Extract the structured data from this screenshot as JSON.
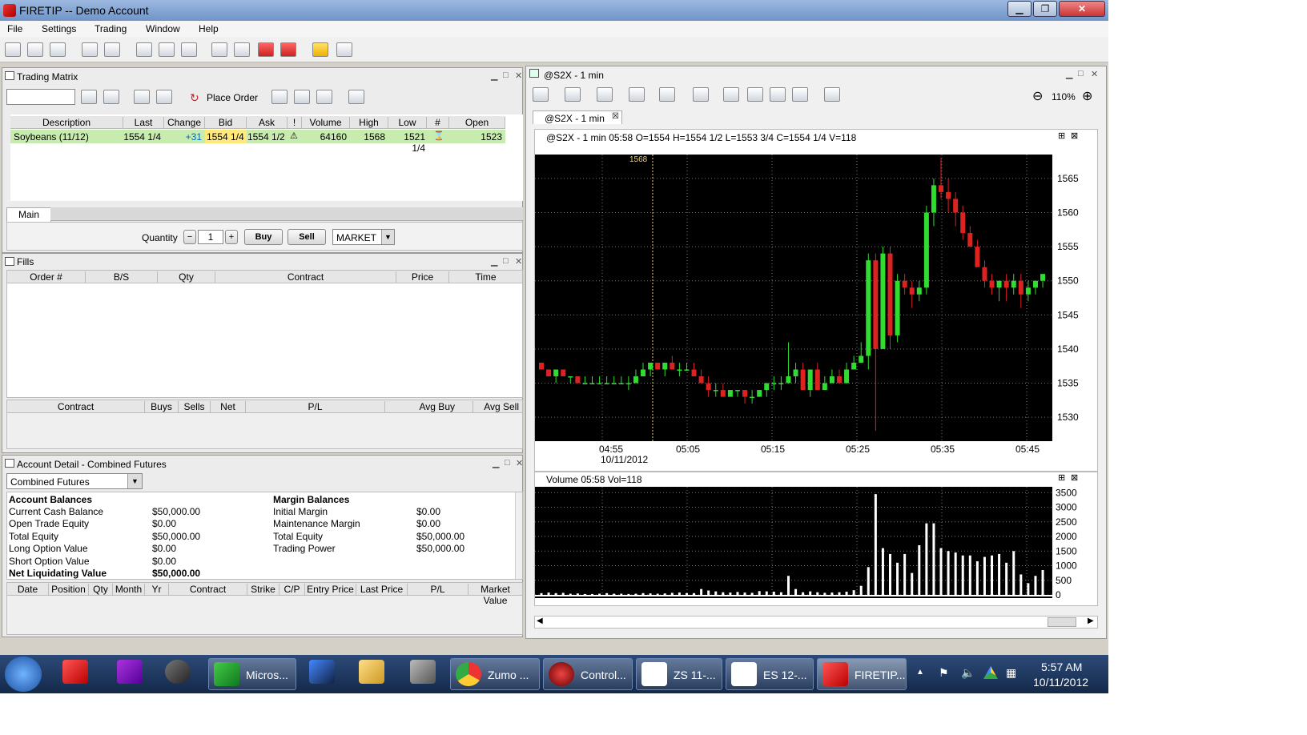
{
  "window": {
    "title": "FIRETIP -- Demo Account"
  },
  "menu": [
    "File",
    "Settings",
    "Trading",
    "Window",
    "Help"
  ],
  "trading_matrix": {
    "title": "Trading Matrix",
    "place_order": "Place Order",
    "columns": [
      "Description",
      "Last",
      "Change",
      "Bid",
      "Ask",
      "!",
      "Volume",
      "High",
      "Low",
      "#",
      "Open"
    ],
    "row": {
      "description": "Soybeans (11/12)",
      "last": "1554 1/4",
      "change": "+31",
      "bid": "1554 1/4",
      "ask": "1554 1/2",
      "volume": "64160",
      "high": "1568",
      "low": "1521 1/4",
      "open": "1523"
    },
    "tab": "Main",
    "quantity_label": "Quantity",
    "quantity_minus": "−",
    "quantity_plus": "+",
    "quantity": "1",
    "buy": "Buy",
    "sell": "Sell",
    "order_type": "MARKET"
  },
  "fills": {
    "title": "Fills",
    "columns": [
      "Order #",
      "B/S",
      "Qty",
      "Contract",
      "Price",
      "Time"
    ],
    "summary_columns": [
      "Contract",
      "Buys",
      "Sells",
      "Net",
      "P/L",
      "Avg Buy",
      "Avg Sell"
    ]
  },
  "account": {
    "title": "Account Detail - Combined Futures",
    "selector": "Combined Futures",
    "balances_heading": "Account Balances",
    "balances": [
      {
        "label": "Current Cash Balance",
        "value": "$50,000.00"
      },
      {
        "label": "Open Trade Equity",
        "value": "$0.00"
      },
      {
        "label": "Total Equity",
        "value": "$50,000.00"
      },
      {
        "label": "Long Option Value",
        "value": "$0.00"
      },
      {
        "label": "Short Option Value",
        "value": "$0.00"
      },
      {
        "label": "Net Liquidating Value",
        "value": "$50,000.00"
      }
    ],
    "margin_heading": "Margin Balances",
    "margins": [
      {
        "label": "Initial Margin",
        "value": "$0.00"
      },
      {
        "label": "Maintenance Margin",
        "value": "$0.00"
      },
      {
        "label": "Total Equity",
        "value": "$50,000.00"
      },
      {
        "label": "Trading Power",
        "value": "$50,000.00"
      }
    ],
    "position_columns": [
      "Date",
      "Position",
      "Qty",
      "Month",
      "Yr",
      "Contract",
      "Strike",
      "C/P",
      "Entry Price",
      "Last Price",
      "P/L",
      "Market Value"
    ]
  },
  "chart_window": {
    "title": "@S2X - 1 min",
    "tab": "@S2X - 1 min",
    "zoom": "110%",
    "header": "@S2X - 1 min 05:58 O=1554 H=1554 1/2 L=1553 3/4 C=1554 1/4 V=118",
    "marker": "1568",
    "volume_header": "Volume 05:58 Vol=118"
  },
  "chart_data": {
    "type": "candlestick",
    "price_ticks": [
      1565,
      1560,
      1555,
      1550,
      1545,
      1540,
      1535,
      1530
    ],
    "ylim": [
      1526.5,
      1568.5
    ],
    "x_ticks": [
      "04:55",
      "05:05",
      "05:15",
      "05:25",
      "05:35",
      "05:45"
    ],
    "x_tick_sub": "10/11/2012",
    "volume_ticks": [
      3500,
      3000,
      2500,
      2000,
      1500,
      1000,
      500,
      0
    ],
    "volume_ylim": [
      0,
      3700
    ],
    "candles": [
      [
        1538,
        1538,
        1537,
        1537
      ],
      [
        1537,
        1537,
        1536,
        1536
      ],
      [
        1536,
        1537,
        1535,
        1537
      ],
      [
        1537,
        1537,
        1536,
        1536
      ],
      [
        1536,
        1536,
        1535,
        1536
      ],
      [
        1536,
        1536,
        1535,
        1535
      ],
      [
        1535,
        1536,
        1535,
        1535
      ],
      [
        1535,
        1536,
        1535,
        1535
      ],
      [
        1535,
        1536,
        1535,
        1535
      ],
      [
        1535,
        1536,
        1535,
        1535
      ],
      [
        1535,
        1536,
        1535,
        1535
      ],
      [
        1535,
        1536,
        1535,
        1535
      ],
      [
        1535,
        1536,
        1534,
        1535
      ],
      [
        1535,
        1537,
        1535,
        1536
      ],
      [
        1536,
        1538,
        1536,
        1537
      ],
      [
        1537,
        1538,
        1536,
        1538
      ],
      [
        1538,
        1538,
        1537,
        1537
      ],
      [
        1537,
        1538,
        1536,
        1538
      ],
      [
        1538,
        1539,
        1537,
        1537
      ],
      [
        1537,
        1538,
        1536,
        1537
      ],
      [
        1537,
        1538,
        1537,
        1537
      ],
      [
        1537,
        1538,
        1536,
        1536
      ],
      [
        1536,
        1537,
        1535,
        1535
      ],
      [
        1535,
        1536,
        1533,
        1534
      ],
      [
        1534,
        1535,
        1533,
        1534
      ],
      [
        1534,
        1535,
        1533,
        1533
      ],
      [
        1533,
        1534,
        1533,
        1534
      ],
      [
        1534,
        1534,
        1533,
        1534
      ],
      [
        1534,
        1534,
        1532,
        1533
      ],
      [
        1533,
        1534,
        1532,
        1533
      ],
      [
        1533,
        1534,
        1533,
        1534
      ],
      [
        1534,
        1535,
        1533,
        1535
      ],
      [
        1535,
        1536,
        1534,
        1535
      ],
      [
        1535,
        1536,
        1534,
        1535
      ],
      [
        1535,
        1541,
        1535,
        1536
      ],
      [
        1536,
        1538,
        1535,
        1537
      ],
      [
        1537,
        1538,
        1534,
        1534
      ],
      [
        1534,
        1537,
        1533,
        1537
      ],
      [
        1537,
        1538,
        1534,
        1534
      ],
      [
        1534,
        1536,
        1534,
        1535
      ],
      [
        1535,
        1537,
        1535,
        1536
      ],
      [
        1536,
        1537,
        1535,
        1535
      ],
      [
        1535,
        1538,
        1535,
        1537
      ],
      [
        1537,
        1539,
        1537,
        1538
      ],
      [
        1538,
        1541,
        1538,
        1539
      ],
      [
        1539,
        1554,
        1537,
        1553
      ],
      [
        1553,
        1554,
        1528,
        1540
      ],
      [
        1540,
        1555,
        1540,
        1554
      ],
      [
        1554,
        1555,
        1540,
        1542
      ],
      [
        1542,
        1551,
        1541,
        1550
      ],
      [
        1550,
        1551,
        1548,
        1549
      ],
      [
        1549,
        1550,
        1546,
        1548
      ],
      [
        1548,
        1550,
        1547,
        1549
      ],
      [
        1549,
        1561,
        1548,
        1560
      ],
      [
        1560,
        1565,
        1558,
        1564
      ],
      [
        1564,
        1568,
        1562,
        1563
      ],
      [
        1563,
        1565,
        1560,
        1562
      ],
      [
        1562,
        1563,
        1558,
        1560
      ],
      [
        1560,
        1561,
        1556,
        1557
      ],
      [
        1557,
        1558,
        1555,
        1555
      ],
      [
        1555,
        1556,
        1552,
        1552
      ],
      [
        1552,
        1553,
        1549,
        1550
      ],
      [
        1550,
        1551,
        1548,
        1549
      ],
      [
        1549,
        1550,
        1547,
        1550
      ],
      [
        1550,
        1551,
        1547,
        1549
      ],
      [
        1549,
        1551,
        1548,
        1550
      ],
      [
        1550,
        1551,
        1546,
        1548
      ],
      [
        1548,
        1550,
        1547,
        1549
      ],
      [
        1549,
        1550,
        1548,
        1550
      ],
      [
        1550,
        1551,
        1549,
        1551
      ]
    ],
    "volume": [
      60,
      80,
      60,
      70,
      40,
      50,
      30,
      30,
      40,
      60,
      40,
      40,
      30,
      40,
      60,
      50,
      40,
      50,
      70,
      80,
      60,
      60,
      200,
      150,
      120,
      90,
      80,
      100,
      80,
      70,
      130,
      120,
      110,
      90,
      650,
      200,
      90,
      120,
      90,
      70,
      80,
      90,
      110,
      160,
      310,
      950,
      3450,
      1600,
      1400,
      1100,
      1400,
      750,
      1700,
      2450,
      2450,
      1600,
      1500,
      1450,
      1350,
      1350,
      1150,
      1300,
      1350,
      1400,
      1100,
      1500,
      700,
      400,
      650,
      850
    ]
  },
  "taskbar": {
    "items": [
      "Micros...",
      "Zumo ...",
      "Control...",
      "ZS 11-...",
      "ES 12-...",
      "FIRETIP..."
    ],
    "time": "5:57 AM",
    "date": "10/11/2012"
  }
}
